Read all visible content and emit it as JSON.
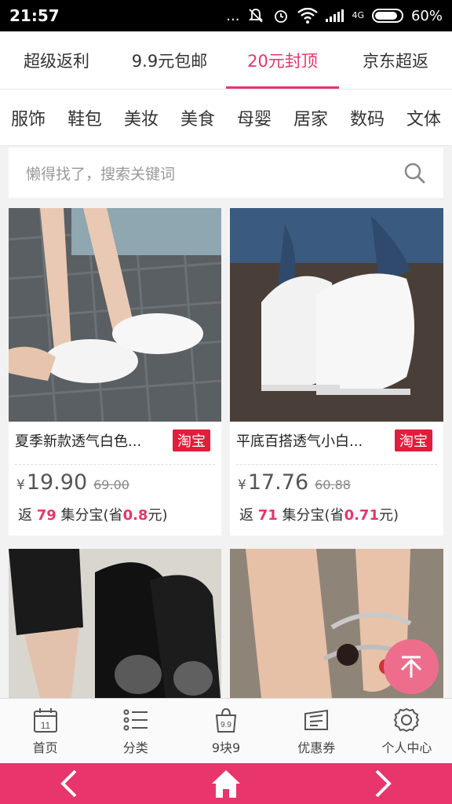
{
  "status": {
    "time": "21:57",
    "dots": "...",
    "network": "4G",
    "battery": "60%"
  },
  "top_tabs": [
    {
      "label": "超级返利"
    },
    {
      "label": "9.9元包邮"
    },
    {
      "label": "20元封顶"
    },
    {
      "label": "京东超返"
    }
  ],
  "categories": [
    {
      "label": "服饰"
    },
    {
      "label": "鞋包"
    },
    {
      "label": "美妆"
    },
    {
      "label": "美食"
    },
    {
      "label": "母婴"
    },
    {
      "label": "居家"
    },
    {
      "label": "数码"
    },
    {
      "label": "文体"
    }
  ],
  "search": {
    "placeholder": "懒得找了，搜索关键词",
    "icon": "search-icon"
  },
  "products": [
    {
      "title": "夏季新款透气白色...",
      "tag": "淘宝",
      "currency": "¥",
      "price": "19.90",
      "original_price": "69.00",
      "rebate_prefix": "返",
      "rebate_points": "79",
      "rebate_mid": "集分宝(省",
      "rebate_save": "0.8",
      "rebate_suffix": "元)"
    },
    {
      "title": "平底百搭透气小白...",
      "tag": "淘宝",
      "currency": "¥",
      "price": "17.76",
      "original_price": "60.88",
      "rebate_prefix": "返",
      "rebate_points": "71",
      "rebate_mid": "集分宝(省",
      "rebate_save": "0.71",
      "rebate_suffix": "元)"
    }
  ],
  "bottom_nav": [
    {
      "label": "首页",
      "icon": "calendar-icon",
      "icon_text": "11"
    },
    {
      "label": "分类",
      "icon": "list-icon"
    },
    {
      "label": "9块9",
      "icon": "bag-icon",
      "icon_text": "9.9"
    },
    {
      "label": "优惠券",
      "icon": "coupon-icon"
    },
    {
      "label": "个人中心",
      "icon": "gear-icon"
    }
  ],
  "colors": {
    "accent": "#e8356b",
    "tag": "#e21d3c"
  }
}
